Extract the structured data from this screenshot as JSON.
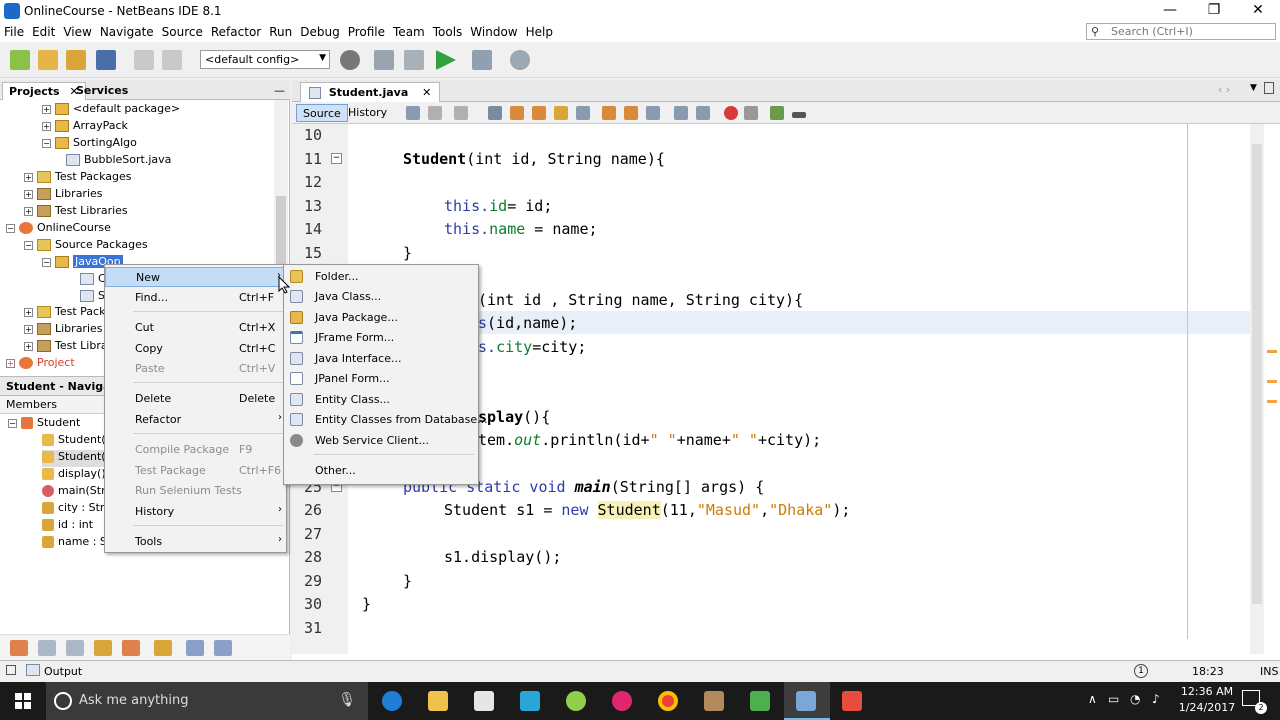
{
  "window": {
    "title": "OnlineCourse - NetBeans IDE 8.1",
    "min_glyph": "—",
    "max_glyph": "❐",
    "close_glyph": "✕"
  },
  "menu": [
    "File",
    "Edit",
    "View",
    "Navigate",
    "Source",
    "Refactor",
    "Run",
    "Debug",
    "Profile",
    "Team",
    "Tools",
    "Window",
    "Help"
  ],
  "search": {
    "placeholder": "Search (Ctrl+I)"
  },
  "toolbar": {
    "config_value": "<default config>"
  },
  "projects_panel": {
    "tabs": {
      "projects": "Projects",
      "services": "Services"
    },
    "close_glyph": "✕",
    "minimize_glyph": "—",
    "tree": [
      {
        "label": "<default package>",
        "icon": "package-icon"
      },
      {
        "label": "ArrayPack",
        "icon": "package-icon"
      },
      {
        "label": "SortingAlgo",
        "icon": "package-icon"
      },
      {
        "label": "BubbleSort.java",
        "icon": "java-file-icon"
      },
      {
        "label": "Test Packages",
        "icon": "folder-icon"
      },
      {
        "label": "Libraries",
        "icon": "libraries-icon"
      },
      {
        "label": "Test Libraries",
        "icon": "libraries-icon"
      },
      {
        "label": "OnlineCourse",
        "icon": "project-icon"
      },
      {
        "label": "Source Packages",
        "icon": "folder-icon"
      },
      {
        "label": "JavaOop",
        "icon": "package-icon"
      },
      {
        "label": "C",
        "icon": "java-file-icon"
      },
      {
        "label": "S",
        "icon": "java-file-icon"
      },
      {
        "label": "Test Pack",
        "icon": "folder-icon"
      },
      {
        "label": "Libraries",
        "icon": "libraries-icon"
      },
      {
        "label": "Test Libra",
        "icon": "libraries-icon"
      },
      {
        "label": "Project",
        "icon": "project-icon"
      }
    ]
  },
  "navigator": {
    "title": "Student - Navigator",
    "members_label": "Members",
    "items": [
      {
        "label": "Student",
        "icon": "class-icon"
      },
      {
        "label": "Student(",
        "icon": "constructor-icon"
      },
      {
        "label": "Student(i",
        "icon": "constructor-icon"
      },
      {
        "label": "display()",
        "icon": "method-icon"
      },
      {
        "label": "main(Stri",
        "icon": "static-method-icon"
      },
      {
        "label": "city : Stri",
        "icon": "field-icon"
      },
      {
        "label": "id : int",
        "icon": "field-icon"
      },
      {
        "label": "name : S",
        "icon": "field-icon"
      }
    ]
  },
  "editor": {
    "tab_label": "Student.java",
    "tab_close": "✕",
    "source_label": "Source",
    "history_label": "History",
    "line_numbers": [
      "10",
      "11",
      "12",
      "13",
      "14",
      "15",
      "25",
      "26",
      "27",
      "28",
      "29",
      "30",
      "31"
    ],
    "visible_code_fragments": {
      "l11": "Student",
      "l11b": "(int id, String name){",
      "l13a": "this.",
      "l13b": "id",
      "l13c": "= id;",
      "l14a": "this.",
      "l14b": "name",
      "l14c": " = name;",
      "l15": "}",
      "l17": "(int id , String name, String city){",
      "l18a": "s",
      "l18b": "(id,name);",
      "l19a": "s.",
      "l19b": "city",
      "l19c": "=city;",
      "l22": "splay",
      "l22b": "(){",
      "l23a": "tem.",
      "l23b": "out",
      "l23c": ".println(id+",
      "l23d": "\" \"",
      "l23e": "+name+",
      "l23f": "\" \"",
      "l23g": "+city);",
      "l25a": "public static void ",
      "l25b": "main",
      "l25c": "(String[] args) {",
      "l26a": "Student s1 = ",
      "l26b": "new ",
      "l26c": "Student",
      "l26d": "(11,",
      "l26e": "\"Masud\"",
      "l26f": ",",
      "l26g": "\"Dhaka\"",
      "l26h": ");",
      "l28": "s1.display();",
      "l29": "}",
      "l30": "}"
    }
  },
  "context_menu": {
    "items": [
      {
        "label": "New",
        "shortcut": "",
        "submenu": true,
        "disabled": false
      },
      {
        "label": "Find...",
        "shortcut": "Ctrl+F",
        "disabled": false
      },
      {
        "label": "Cut",
        "shortcut": "Ctrl+X",
        "disabled": false
      },
      {
        "label": "Copy",
        "shortcut": "Ctrl+C",
        "disabled": false
      },
      {
        "label": "Paste",
        "shortcut": "Ctrl+V",
        "disabled": true
      },
      {
        "label": "Delete",
        "shortcut": "Delete",
        "disabled": false
      },
      {
        "label": "Refactor",
        "shortcut": "",
        "submenu": true,
        "disabled": false
      },
      {
        "label": "Compile Package",
        "shortcut": "F9",
        "disabled": true
      },
      {
        "label": "Test Package",
        "shortcut": "Ctrl+F6",
        "disabled": true
      },
      {
        "label": "Run Selenium Tests",
        "shortcut": "",
        "disabled": true
      },
      {
        "label": "History",
        "shortcut": "",
        "submenu": true,
        "disabled": false
      },
      {
        "label": "Tools",
        "shortcut": "",
        "submenu": true,
        "disabled": false
      }
    ],
    "submenu_arrow": "›"
  },
  "new_submenu": {
    "items": [
      {
        "label": "Folder...",
        "icon": "folder-icon"
      },
      {
        "label": "Java Class...",
        "icon": "java-class-icon"
      },
      {
        "label": "Java Package...",
        "icon": "package-icon"
      },
      {
        "label": "JFrame Form...",
        "icon": "jframe-icon"
      },
      {
        "label": "Java Interface...",
        "icon": "interface-icon"
      },
      {
        "label": "JPanel Form...",
        "icon": "jpanel-icon"
      },
      {
        "label": "Entity Class...",
        "icon": "entity-icon"
      },
      {
        "label": "Entity Classes from Database...",
        "icon": "entity-db-icon"
      },
      {
        "label": "Web Service Client...",
        "icon": "web-service-icon"
      },
      {
        "label": "Other...",
        "icon": ""
      }
    ]
  },
  "statusbar": {
    "output_label": "Output",
    "position": "18:23",
    "mode": "INS",
    "notification_count": "1"
  },
  "taskbar": {
    "search_placeholder": "Ask me anything",
    "time": "12:36 AM",
    "date": "1/24/2017",
    "notification_badge": "2"
  },
  "colors": {
    "keyword": "#2f3bab",
    "field": "#0a7d2d",
    "string": "#ce7b00",
    "menu_highlight": "#c5dcf7",
    "taskbar": "#1a1a1a"
  }
}
